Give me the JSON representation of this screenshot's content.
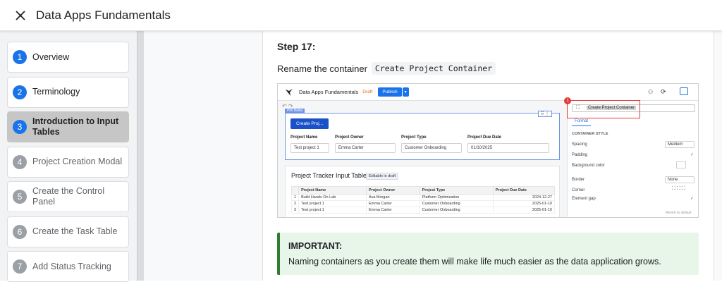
{
  "header": {
    "title": "Data Apps Fundamentals"
  },
  "sidebar": {
    "items": [
      {
        "num": "1",
        "label": "Overview",
        "state": "done"
      },
      {
        "num": "2",
        "label": "Terminology",
        "state": "done"
      },
      {
        "num": "3",
        "label": "Introduction to Input Tables",
        "state": "current"
      },
      {
        "num": "4",
        "label": "Project Creation Modal",
        "state": "todo"
      },
      {
        "num": "5",
        "label": "Create the Control Panel",
        "state": "todo"
      },
      {
        "num": "6",
        "label": "Create the Task Table",
        "state": "todo"
      },
      {
        "num": "7",
        "label": "Add Status Tracking",
        "state": "todo"
      }
    ]
  },
  "main": {
    "step_heading": "Step 17:",
    "instruction_prefix": "Rename the container",
    "instruction_code": "Create Project Container",
    "callout": {
      "title": "IMPORTANT:",
      "text": "Naming containers as you create them will make life much easier as the data application grows."
    }
  },
  "screenshot": {
    "app_title": "Data Apps Fundamentals",
    "draft": "Draft",
    "publish": "Publish",
    "container_tag": "Phil Ballai",
    "create_button": "Create Proj...",
    "controls": [
      {
        "label": "Project Name",
        "value": "Test project 1"
      },
      {
        "label": "Project Owner",
        "value": "Emma Carter"
      },
      {
        "label": "Project Type",
        "value": "Customer Onboarding"
      },
      {
        "label": "Project Due Date",
        "value": "01/10/2025"
      }
    ],
    "table_title": "Project Tracker Input Table",
    "editable_chip": "Editable in draft",
    "table_headers": [
      "Project Name",
      "Project Owner",
      "Project Type",
      "Project Due Date"
    ],
    "table_rows": [
      [
        "1",
        "Build Hands On Lab",
        "Ava Morgan",
        "Platform Optimization",
        "2024-12-27"
      ],
      [
        "2",
        "Test project 1",
        "Emma Carter",
        "Customer Onboarding",
        "2025-01-10"
      ],
      [
        "3",
        "Test project 1",
        "Emma Carter",
        "Customer Onboarding",
        "2025-01-10"
      ]
    ],
    "panel": {
      "name_value": "Create Project Container",
      "badge": "1",
      "tab": "Format",
      "section": "CONTAINER STYLE",
      "props": [
        {
          "label": "Spacing",
          "value": "Medium"
        },
        {
          "label": "Padding",
          "value": ""
        },
        {
          "label": "Background color",
          "value": ""
        },
        {
          "label": "Border",
          "value": "None"
        },
        {
          "label": "Corner",
          "value": ""
        },
        {
          "label": "Element gap",
          "value": ""
        }
      ],
      "revert": "Revert to default"
    }
  }
}
